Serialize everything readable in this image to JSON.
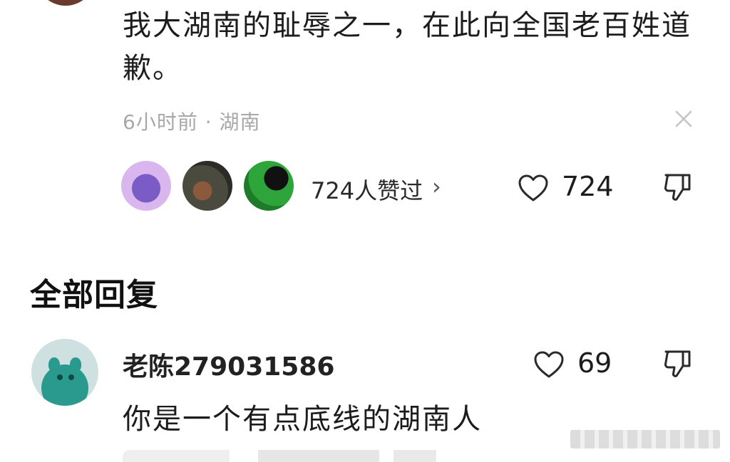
{
  "comment": {
    "text": "我大湖南的耻辱之一，在此向全国老百姓道歉。",
    "meta": "6小时前 · 湖南",
    "likers_label": "724人赞过",
    "chevron": "›",
    "like_count": "724"
  },
  "replies": {
    "title": "全部回复",
    "items": [
      {
        "username": "老陈279031586",
        "text": "你是一个有点底线的湖南人",
        "like_count": "69"
      }
    ]
  },
  "icons": {
    "heart": "heart-icon",
    "dislike": "thumbs-down-icon",
    "close": "close-icon"
  },
  "colors": {
    "meta_text": "#a8a8a8",
    "primary_text": "#1c1c1c",
    "reply_avatar_bg": "#2a9a8f"
  }
}
